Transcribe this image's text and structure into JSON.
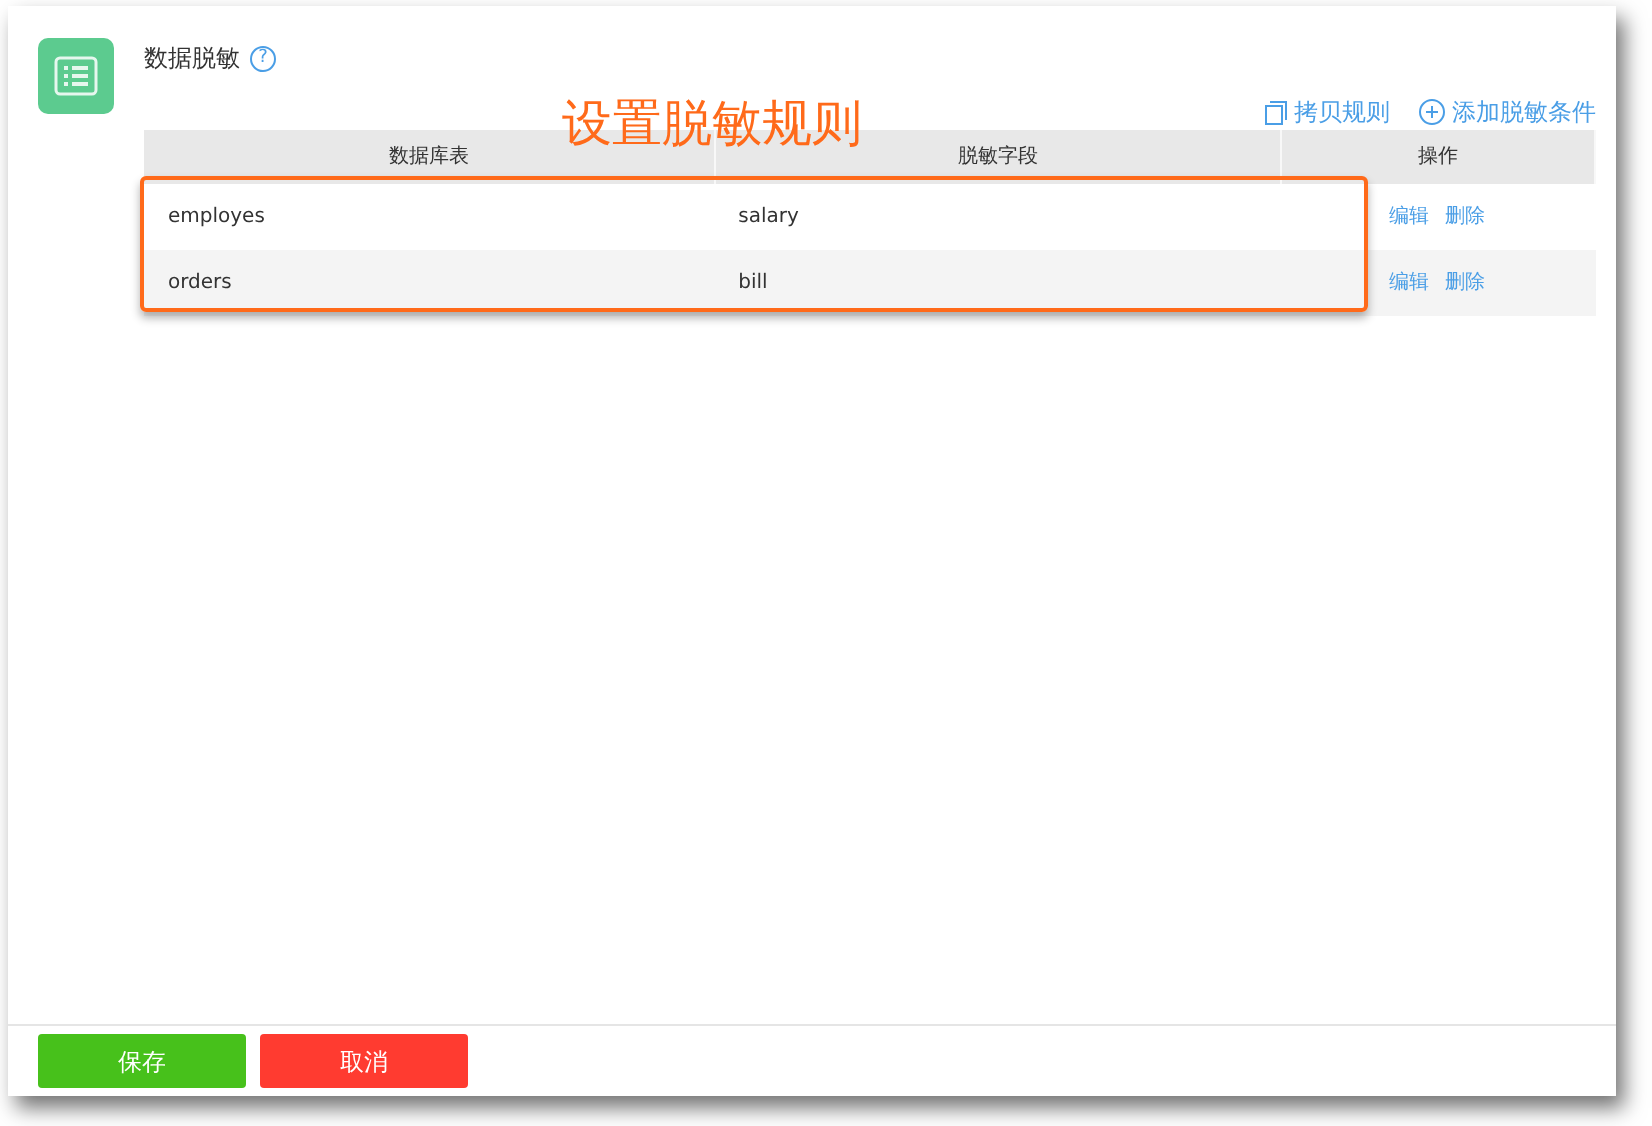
{
  "header": {
    "title": "数据脱敏",
    "help_icon": "?"
  },
  "toolbar": [
    {
      "kind": "copy",
      "label": "拷贝规则"
    },
    {
      "kind": "add",
      "label": "添加脱敏条件"
    }
  ],
  "annotation": {
    "text": "设置脱敏规则",
    "frame_shown": true
  },
  "table": {
    "columns": [
      "数据库表",
      "脱敏字段",
      "操作"
    ],
    "rows": [
      {
        "cells": [
          "employes",
          "salary"
        ],
        "actions": [
          "编辑",
          "删除"
        ]
      },
      {
        "cells": [
          "orders",
          "bill"
        ],
        "actions": [
          "编辑",
          "删除"
        ]
      }
    ]
  },
  "footer": {
    "buttons": [
      {
        "kind": "save",
        "label": "保存"
      },
      {
        "kind": "cancel",
        "label": "取消"
      }
    ]
  }
}
